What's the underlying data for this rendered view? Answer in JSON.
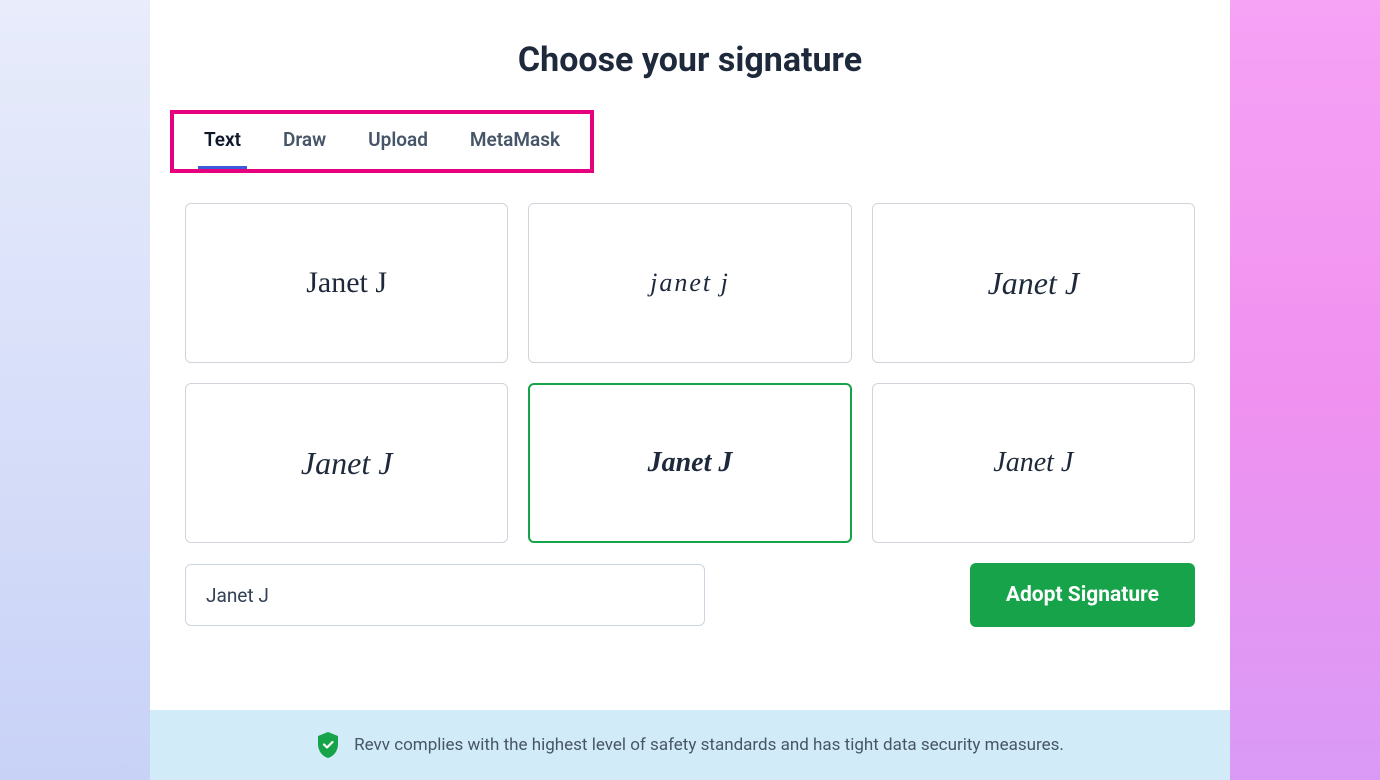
{
  "header": {
    "title": "Choose your signature"
  },
  "tabs": [
    {
      "label": "Text",
      "active": true
    },
    {
      "label": "Draw",
      "active": false
    },
    {
      "label": "Upload",
      "active": false
    },
    {
      "label": "MetaMask",
      "active": false
    }
  ],
  "signature_name": "Janet J",
  "signature_options": [
    {
      "text": "Janet J",
      "selected": false
    },
    {
      "text": "Janet J",
      "selected": false
    },
    {
      "text": "Janet J",
      "selected": false
    },
    {
      "text": "Janet J",
      "selected": false
    },
    {
      "text": "Janet J",
      "selected": true
    },
    {
      "text": "Janet J",
      "selected": false
    }
  ],
  "name_input": {
    "value": "Janet J"
  },
  "adopt_button": {
    "label": "Adopt Signature"
  },
  "footer": {
    "text": "Revv complies with the highest level of safety standards and has tight data security measures."
  },
  "colors": {
    "highlight_border": "#e6007e",
    "selected_border": "#16a34a",
    "primary_button": "#16a34a",
    "tab_underline": "#3b5bdb"
  }
}
